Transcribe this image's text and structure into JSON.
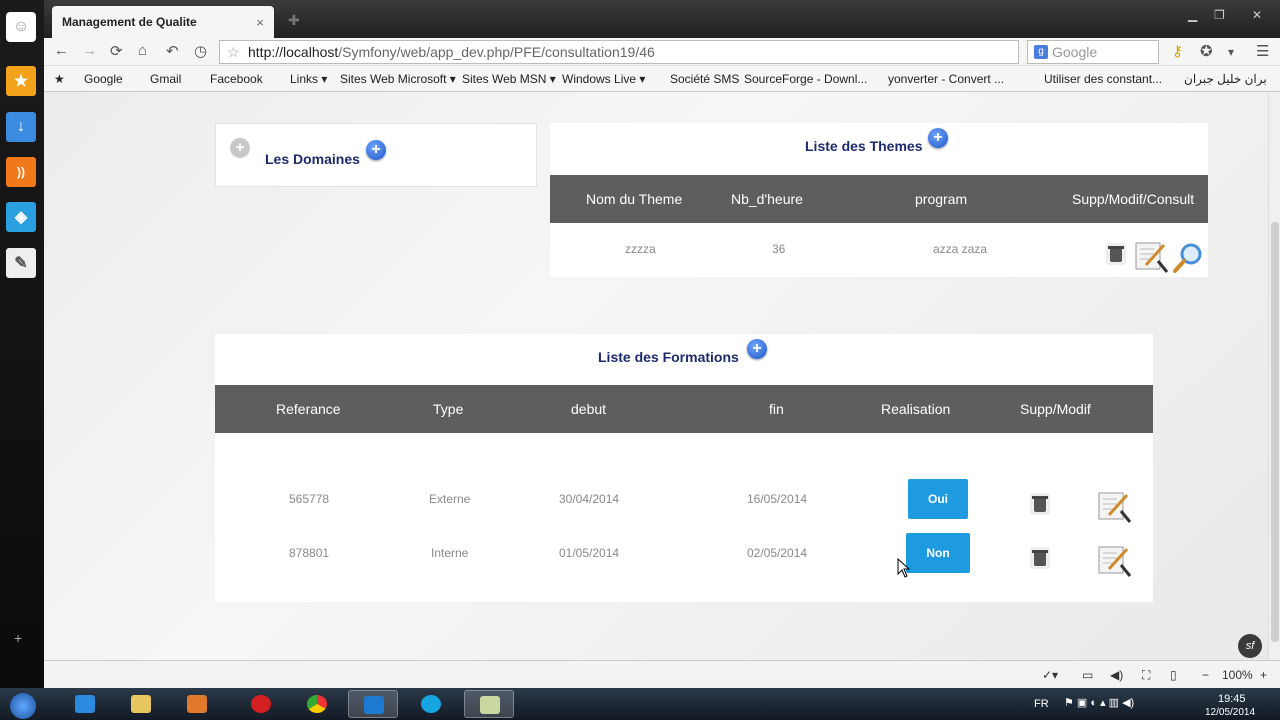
{
  "browser": {
    "tab_title": "Management de Qualite",
    "tab_close": "×",
    "url_host": "http://localhost",
    "url_path": "/Symfony/web/app_dev.php/PFE/consultation19/46",
    "search_placeholder": "Google",
    "bookmarks": [
      {
        "label": "Google"
      },
      {
        "label": "Gmail"
      },
      {
        "label": "Facebook"
      },
      {
        "label": "Links ▾"
      },
      {
        "label": "Sites Web Microsoft ▾"
      },
      {
        "label": "Sites Web MSN ▾"
      },
      {
        "label": "Windows Live ▾"
      },
      {
        "label": "Société SMS"
      },
      {
        "label": "SourceForge - Downl..."
      },
      {
        "label": "yonverter - Convert ..."
      },
      {
        "label": "Utiliser des constant..."
      },
      {
        "label": "بران خليل جبران"
      }
    ]
  },
  "domaines": {
    "title": "Les Domaines"
  },
  "themes": {
    "title": "Liste des Themes",
    "headers": [
      "Nom du Theme",
      "Nb_d'heure",
      "program",
      "Supp/Modif/Consult"
    ],
    "rows": [
      {
        "nom": "zzzza",
        "nb": "36",
        "program": "azza zaza"
      }
    ]
  },
  "formations": {
    "title": "Liste des Formations",
    "headers": [
      "Referance",
      "Type",
      "debut",
      "fin",
      "Realisation",
      "Supp/Modif"
    ],
    "rows": [
      {
        "ref": "565778",
        "type": "Externe",
        "debut": "30/04/2014",
        "fin": "16/05/2014",
        "realisation": "Oui"
      },
      {
        "ref": "878801",
        "type": "Interne",
        "debut": "01/05/2014",
        "fin": "02/05/2014",
        "realisation": "Non"
      }
    ]
  },
  "statusbar": {
    "zoom": "100%"
  },
  "taskbar": {
    "lang": "FR",
    "time": "19:45",
    "date": "12/05/2014"
  },
  "colors": {
    "accent_blue": "#1e9ae0",
    "title_navy": "#1e2a6e",
    "header_grey": "#5e5e5e"
  }
}
